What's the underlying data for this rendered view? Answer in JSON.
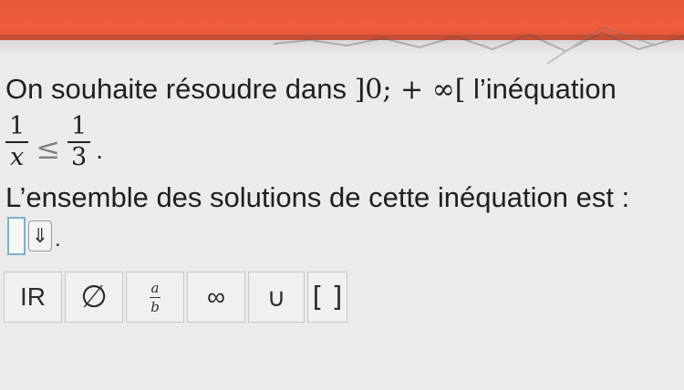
{
  "question": {
    "prefix": "On souhaite résoudre dans ",
    "interval": "]0; + ∞[",
    "suffix": " l’inéquation"
  },
  "inequality": {
    "lhs_num": "1",
    "lhs_den": "x",
    "relation": "≤",
    "rhs_num": "1",
    "rhs_den": "3",
    "end": "."
  },
  "solution_prompt": "L’ensemble des solutions de cette inéquation est :",
  "answer": {
    "value": "",
    "dropdown_icon": "⇓",
    "end": "."
  },
  "keypad": {
    "reals": "IR",
    "empty_set": "∅",
    "fraction_num": "a",
    "fraction_den": "b",
    "infinity": "∞",
    "union": "∪",
    "brackets": "[ ]"
  }
}
